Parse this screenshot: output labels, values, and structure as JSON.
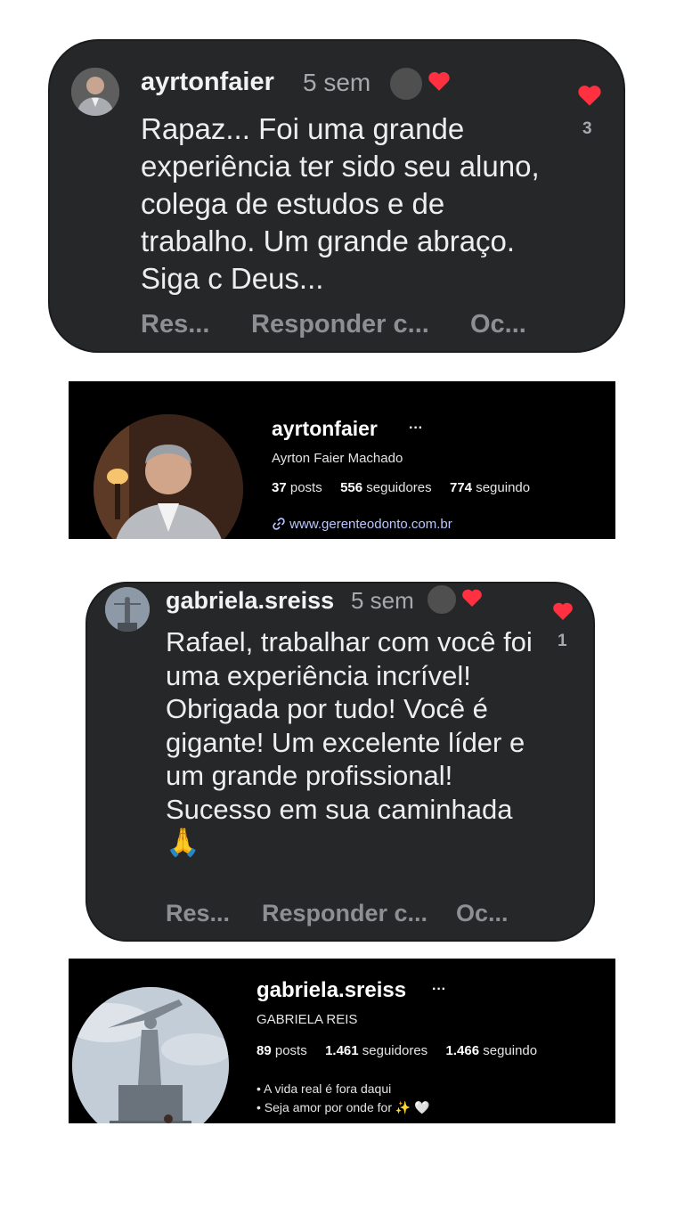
{
  "comment1": {
    "username": "ayrtonfaier",
    "time": "5 sem",
    "text": "Rapaz... Foi uma grande experiência ter sido seu aluno, colega de estudos e de trabalho. Um grande abraço. Siga c Deus...",
    "like_count": "3",
    "actions": [
      "Res...",
      "Responder c...",
      "Oc..."
    ]
  },
  "profile1": {
    "username": "ayrtonfaier",
    "more": "···",
    "full_name": "Ayrton Faier Machado",
    "posts_count": "37",
    "posts_label": "posts",
    "followers_count": "556",
    "followers_label": "seguidores",
    "following_count": "774",
    "following_label": "seguindo",
    "link": "www.gerenteodonto.com.br"
  },
  "comment2": {
    "username": "gabriela.sreiss",
    "time": "5 sem",
    "text": "Rafael, trabalhar com você foi uma experiência incrível!  Obrigada por tudo! Você é gigante! Um excelente líder e um grande profissional! Sucesso em sua caminhada 🙏",
    "like_count": "1",
    "actions": [
      "Res...",
      "Responder c...",
      "Oc..."
    ]
  },
  "profile2": {
    "username": "gabriela.sreiss",
    "more": "···",
    "full_name": "GABRIELA REIS",
    "posts_count": "89",
    "posts_label": "posts",
    "followers_count": "1.461",
    "followers_label": "seguidores",
    "following_count": "1.466",
    "following_label": "seguindo",
    "bio": [
      "• A vida real é fora daqui",
      "• Seja amor por onde for ✨ 🤍"
    ]
  },
  "colors": {
    "comment_bg": "#262729",
    "heart": "#ff3040",
    "link": "#b9c6ff"
  },
  "icons": [
    "heart-icon",
    "link-icon",
    "more-icon"
  ]
}
